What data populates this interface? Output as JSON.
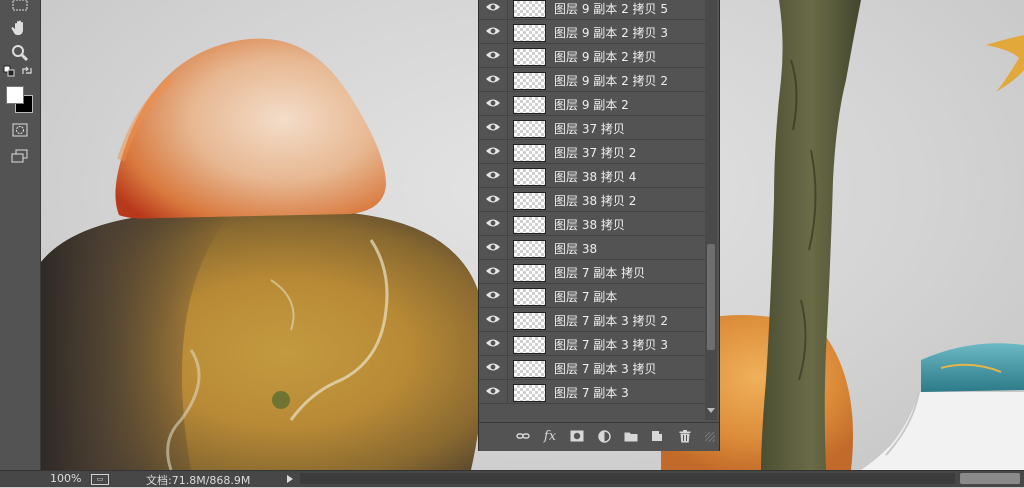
{
  "toolbar": {
    "tools": [
      "marquee-icon",
      "hand-icon",
      "zoom-icon",
      "default-colors-icon",
      "swap-colors-icon",
      "quick-mask-icon",
      "screen-mode-icon"
    ],
    "foreground_color": "#ffffff",
    "background_color": "#000000"
  },
  "layers_panel": {
    "layers": [
      {
        "name": "图层 9 副本 2 拷贝 5",
        "visible": true
      },
      {
        "name": "图层 9 副本 2 拷贝 3",
        "visible": true
      },
      {
        "name": "图层 9 副本 2 拷贝",
        "visible": true
      },
      {
        "name": "图层 9 副本 2 拷贝 2",
        "visible": true
      },
      {
        "name": "图层 9 副本 2",
        "visible": true
      },
      {
        "name": "图层 37 拷贝",
        "visible": true
      },
      {
        "name": "图层 37 拷贝 2",
        "visible": true
      },
      {
        "name": "图层 38 拷贝 4",
        "visible": true
      },
      {
        "name": "图层 38 拷贝 2",
        "visible": true
      },
      {
        "name": "图层 38 拷贝",
        "visible": true
      },
      {
        "name": "图层 38",
        "visible": true
      },
      {
        "name": "图层 7 副本 拷贝",
        "visible": true
      },
      {
        "name": "图层 7 副本",
        "visible": true
      },
      {
        "name": "图层 7 副本 3 拷贝 2",
        "visible": true
      },
      {
        "name": "图层 7 副本 3 拷贝 3",
        "visible": true
      },
      {
        "name": "图层 7 副本 3 拷贝",
        "visible": true
      },
      {
        "name": "图层 7 副本 3",
        "visible": true
      }
    ],
    "footer_buttons": [
      "link-layers-icon",
      "fx-icon",
      "add-mask-icon",
      "adjustment-layer-icon",
      "new-group-icon",
      "new-layer-icon",
      "delete-layer-icon"
    ],
    "fx_label": "fx"
  },
  "status": {
    "zoom": "100%",
    "doc_size": "文档:71.8M/868.9M"
  }
}
